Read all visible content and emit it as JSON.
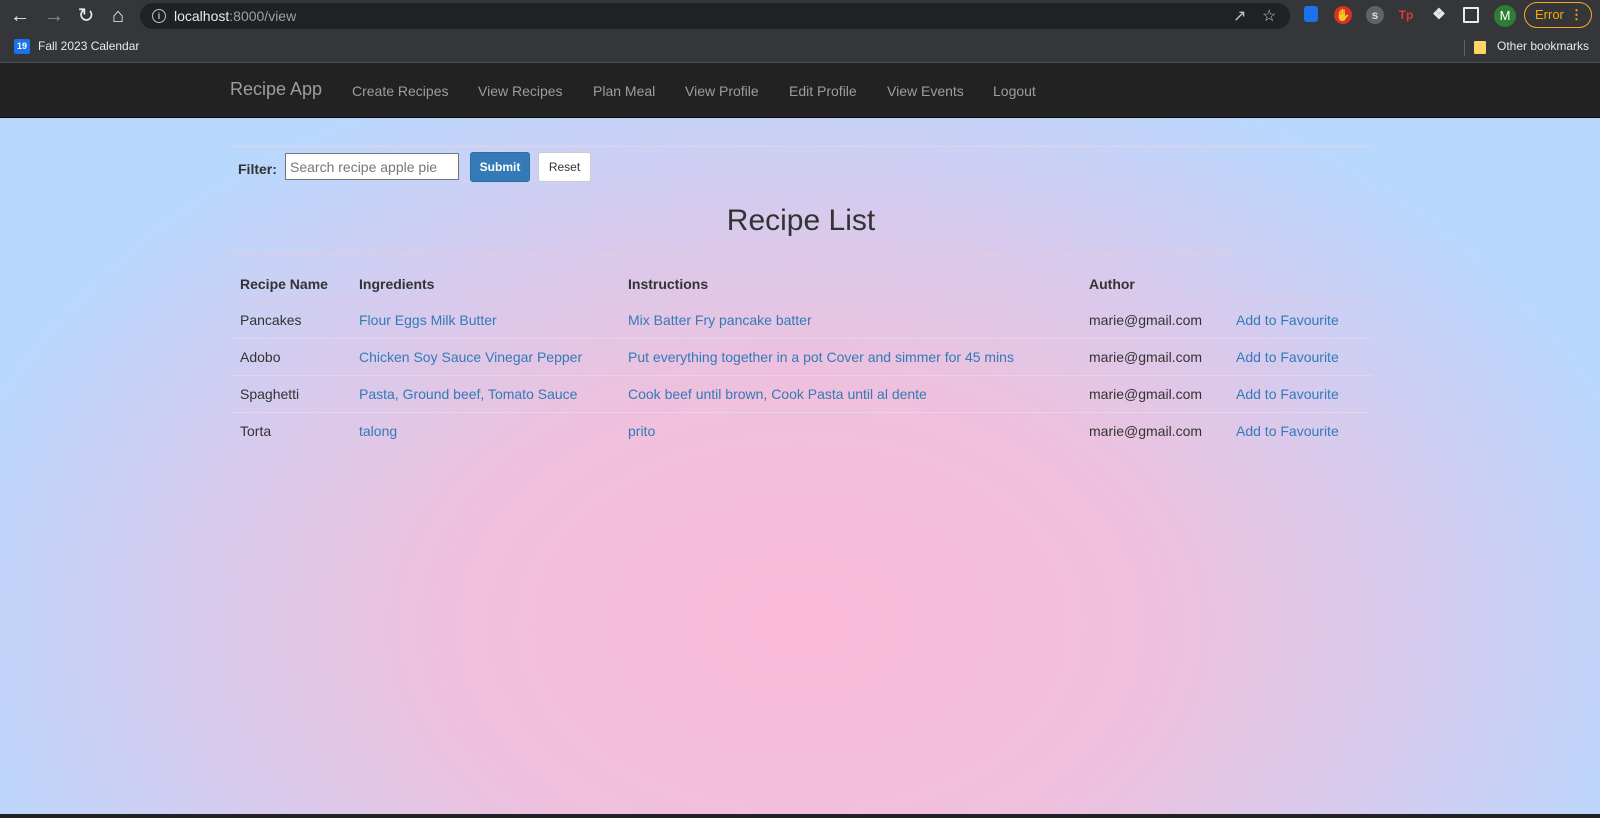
{
  "browser": {
    "url_host": "localhost",
    "url_rest": ":8000/view",
    "profile_initial": "M",
    "error_label": "Error",
    "bookmarks": {
      "calendar_icon": "19",
      "calendar_label": "Fall 2023 Calendar",
      "other_label": "Other bookmarks"
    }
  },
  "navbar": {
    "brand": "Recipe App",
    "links": [
      {
        "label": "Create Recipes"
      },
      {
        "label": "View Recipes"
      },
      {
        "label": "Plan Meal"
      },
      {
        "label": "View Profile"
      },
      {
        "label": "Edit Profile"
      },
      {
        "label": "View Events"
      },
      {
        "label": "Logout"
      }
    ]
  },
  "filter": {
    "label": "Filter:",
    "placeholder": "Search recipe apple pie",
    "submit_label": "Submit",
    "reset_label": "Reset"
  },
  "recipe_list": {
    "title": "Recipe List",
    "headers": [
      "Recipe Name",
      "Ingredients",
      "Instructions",
      "Author",
      ""
    ],
    "rows": [
      {
        "name": "Pancakes",
        "ingredients": "Flour Eggs Milk Butter",
        "instructions": "Mix Batter Fry pancake batter",
        "author": "marie@gmail.com",
        "action": "Add to Favourite"
      },
      {
        "name": "Adobo",
        "ingredients": "Chicken Soy Sauce Vinegar Pepper",
        "instructions": "Put everything together in a pot Cover and simmer for 45 mins",
        "author": "marie@gmail.com",
        "action": "Add to Favourite"
      },
      {
        "name": "Spaghetti",
        "ingredients": "Pasta, Ground beef, Tomato Sauce",
        "instructions": "Cook beef until brown, Cook Pasta until al dente",
        "author": "marie@gmail.com",
        "action": "Add to Favourite"
      },
      {
        "name": "Torta",
        "ingredients": "talong",
        "instructions": "prito",
        "author": "marie@gmail.com",
        "action": "Add to Favourite"
      }
    ]
  },
  "colors": {
    "link": "#337ab7",
    "navbar_bg": "#222222",
    "submit_bg": "#337ab7"
  }
}
